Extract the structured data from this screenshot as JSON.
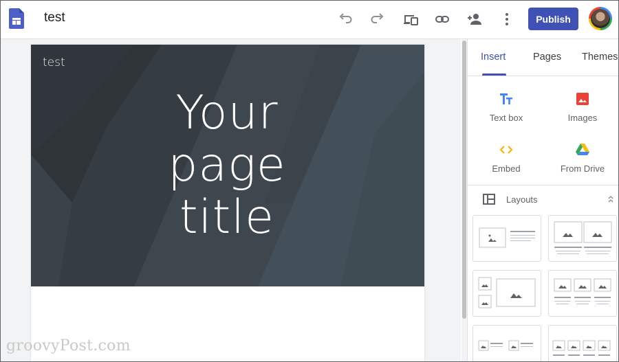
{
  "app": {
    "title": "test"
  },
  "toolbar": {
    "publish_label": "Publish"
  },
  "page": {
    "site_name": "test",
    "title_line1": "Your",
    "title_line2": "page",
    "title_line3": "title"
  },
  "panel": {
    "tabs": [
      {
        "label": "Insert",
        "active": true
      },
      {
        "label": "Pages"
      },
      {
        "label": "Themes"
      }
    ],
    "insert_items": [
      {
        "label": "Text box",
        "icon": "text-box-icon"
      },
      {
        "label": "Images",
        "icon": "image-icon"
      },
      {
        "label": "Embed",
        "icon": "embed-icon"
      },
      {
        "label": "From Drive",
        "icon": "drive-icon"
      }
    ],
    "layouts_label": "Layouts"
  },
  "watermark": "groovyPost.com",
  "colors": {
    "accent": "#3f51b5",
    "hero_bg": "#3b434a",
    "canvas_bg": "#f1f3f4"
  }
}
